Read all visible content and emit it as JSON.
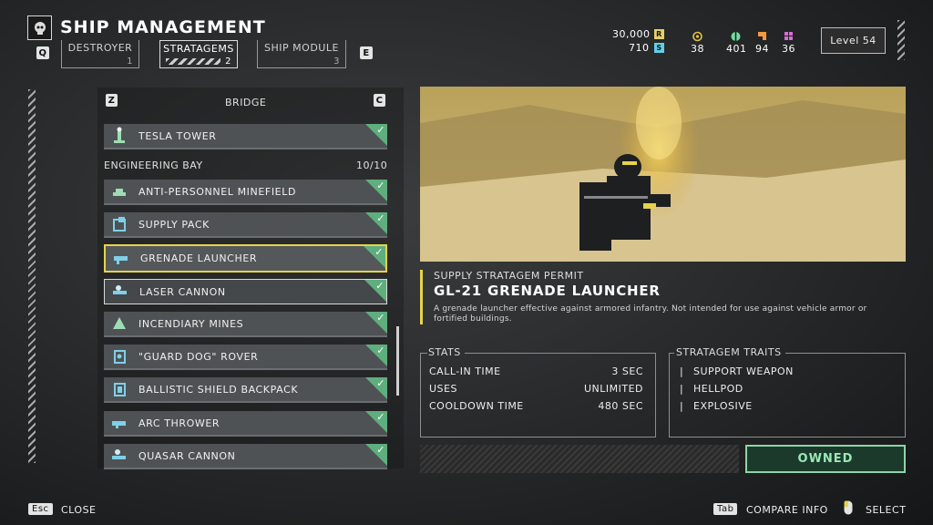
{
  "header": {
    "title": "SHIP MANAGEMENT",
    "left_key": "Q",
    "right_key": "E",
    "tabs": [
      {
        "label": "DESTROYER",
        "num": "1"
      },
      {
        "label": "STRATAGEMS",
        "num": "2"
      },
      {
        "label": "SHIP MODULE",
        "num": "3"
      }
    ],
    "active_tab": "STRATAGEMS"
  },
  "currencies": {
    "requisition": "30,000",
    "requisition_icon": "R",
    "super_credits": "710",
    "super_credits_icon": "S",
    "medals": "38",
    "common_samples": "401",
    "rare_samples": "94",
    "super_samples": "36",
    "level": "Level 54",
    "colors": {
      "medal": "#e2c24a",
      "common": "#6fe0a0",
      "rare": "#f29a3c",
      "super": "#d86bd8",
      "req": "#e5cf6a",
      "sc": "#5fd0e8"
    }
  },
  "list": {
    "prev_key": "Z",
    "next_key": "C",
    "bridge_title": "BRIDGE",
    "bridge_items": [
      {
        "label": "TESLA TOWER",
        "icon": "tesla-tower-icon"
      }
    ],
    "bay_title": "ENGINEERING BAY",
    "bay_count": "10/10",
    "bay_items": [
      {
        "label": "ANTI-PERSONNEL MINEFIELD",
        "icon": "minefield-icon"
      },
      {
        "label": "SUPPLY PACK",
        "icon": "supply-pack-icon"
      },
      {
        "label": "GRENADE LAUNCHER",
        "icon": "grenade-launcher-icon"
      },
      {
        "label": "LASER CANNON",
        "icon": "laser-cannon-icon"
      },
      {
        "label": "INCENDIARY MINES",
        "icon": "incendiary-mines-icon"
      },
      {
        "label": "\"GUARD DOG\" ROVER",
        "icon": "guard-dog-rover-icon"
      },
      {
        "label": "BALLISTIC SHIELD BACKPACK",
        "icon": "ballistic-shield-icon"
      },
      {
        "label": "ARC THROWER",
        "icon": "arc-thrower-icon"
      },
      {
        "label": "QUASAR CANNON",
        "icon": "quasar-cannon-icon"
      }
    ],
    "selected": "GRENADE LAUNCHER"
  },
  "detail": {
    "permit_type": "SUPPLY STRATAGEM PERMIT",
    "name": "GL-21 GRENADE LAUNCHER",
    "description": "A grenade launcher effective against armored infantry. Not intended for use against vehicle armor or fortified buildings.",
    "stats_title": "STATS",
    "stats": [
      {
        "label": "CALL-IN TIME",
        "value": "3 SEC"
      },
      {
        "label": "USES",
        "value": "UNLIMITED"
      },
      {
        "label": "COOLDOWN TIME",
        "value": "480 SEC"
      }
    ],
    "traits_title": "STRATAGEM TRAITS",
    "traits": [
      "SUPPORT WEAPON",
      "HELLPOD",
      "EXPLOSIVE"
    ],
    "owned_label": "OWNED"
  },
  "footer": {
    "close_key": "Esc",
    "close_label": "CLOSE",
    "compare_key": "Tab",
    "compare_label": "COMPARE INFO",
    "select_label": "SELECT"
  }
}
